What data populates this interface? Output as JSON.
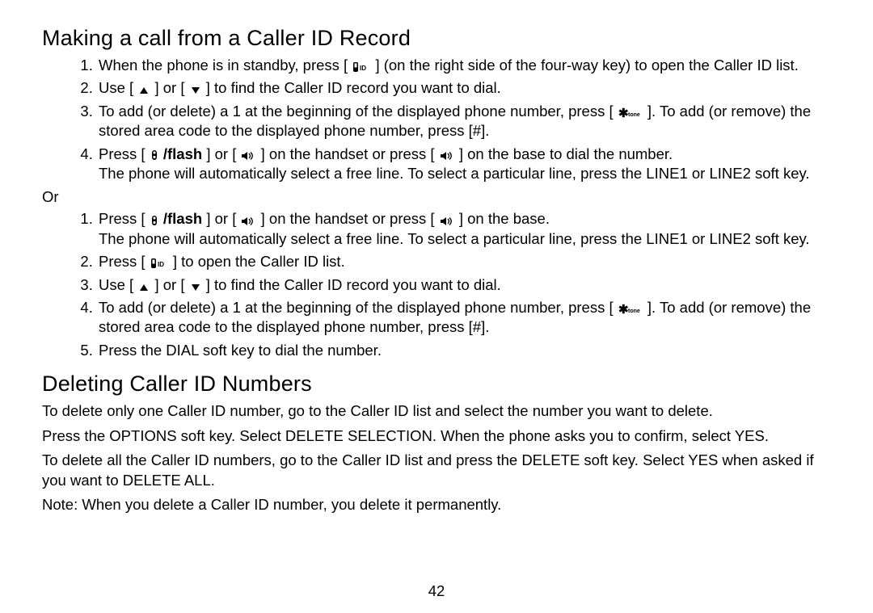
{
  "h1": "Making a call from a Caller ID Record",
  "list1": {
    "i1a": "When the phone is in standby, press [",
    "i1b": "] (on the right side of the four-way key) to open the Caller ID list.",
    "i2a": "Use [",
    "i2b": "] or [",
    "i2c": "] to find the Caller ID record you want to dial.",
    "i3a": "To add (or delete) a  1  at the beginning of the displayed phone number, press [",
    "i3b": "]. To add (or remove) the stored area code to the displayed phone number, press [#].",
    "i4a": "Press [",
    "i4flash": "/flash",
    "i4b": "] or [",
    "i4c": "] on the handset or press [",
    "i4d": "] on the base to dial the number.",
    "i4e": "The phone will automatically select a free line. To select a particular line, press the LINE1 or LINE2 soft key."
  },
  "or": "Or",
  "list2": {
    "i1a": "Press [",
    "i1flash": "/flash",
    "i1b": "] or [",
    "i1c": "] on the handset or press [",
    "i1d": "] on the base.",
    "i1e": "The phone will automatically select a free line. To select a particular line, press the LINE1 or LINE2 soft key.",
    "i2a": "Press [",
    "i2b": "] to open the Caller ID list.",
    "i3a": "Use [",
    "i3b": "] or [",
    "i3c": "] to find the Caller ID record you want to dial.",
    "i4a": "To add (or delete) a  1  at the beginning of the displayed phone number, press [",
    "i4b": "]. To add (or remove) the stored area code to the displayed phone number, press [#].",
    "i5": "Press the DIAL soft key to dial the number."
  },
  "h2": "Deleting Caller ID Numbers",
  "del": {
    "p1": "To delete only one Caller ID number, go to the Caller ID list and select the number you want to delete.",
    "p2": "Press the OPTIONS soft key. Select DELETE SELECTION. When the phone asks you to confirm, select YES.",
    "p3": "To delete all the Caller ID numbers, go to the Caller ID list and press the DELETE soft key. Select YES when asked if you want to DELETE ALL.",
    "p4": "Note: When you delete a Caller ID number, you delete it permanently."
  },
  "page_number": "42",
  "icons": {
    "cid": "caller-id-icon",
    "up": "up-arrow-icon",
    "down": "down-arrow-icon",
    "star_tone": "star-tone-icon",
    "talk": "talk-icon",
    "speaker": "speaker-icon"
  }
}
